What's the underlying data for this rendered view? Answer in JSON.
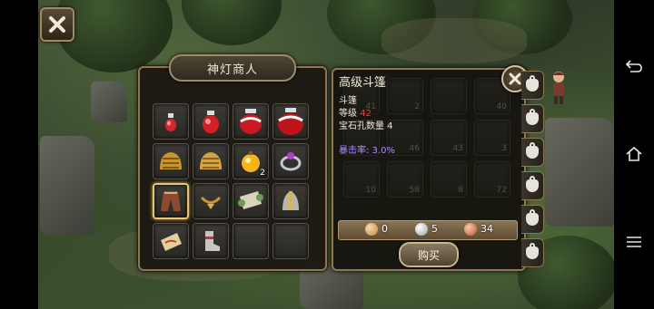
{
  "merchant": {
    "title": "神灯商人",
    "items": [
      {
        "icon": "small-red-potion-icon",
        "qty": ""
      },
      {
        "icon": "red-potion-icon",
        "qty": ""
      },
      {
        "icon": "large-red-potion-icon",
        "qty": ""
      },
      {
        "icon": "jumbo-red-potion-icon",
        "qty": ""
      },
      {
        "icon": "golden-helmet-icon",
        "qty": ""
      },
      {
        "icon": "golden-helmet-2-icon",
        "qty": ""
      },
      {
        "icon": "gold-orb-icon",
        "qty": "2"
      },
      {
        "icon": "purple-ring-icon",
        "qty": ""
      },
      {
        "icon": "cloak-icon",
        "qty": ""
      },
      {
        "icon": "amulet-icon",
        "qty": ""
      },
      {
        "icon": "scroll-icon",
        "qty": ""
      },
      {
        "icon": "silver-helmet-icon",
        "qty": ""
      },
      {
        "icon": "treasure-map-icon",
        "qty": ""
      },
      {
        "icon": "boots-icon",
        "qty": ""
      },
      {
        "icon": "empty-slot",
        "qty": ""
      },
      {
        "icon": "empty-slot",
        "qty": ""
      }
    ],
    "selected_index": 8
  },
  "detail": {
    "name": "高级斗篷",
    "type": "斗篷",
    "level_label": "等级",
    "level_value": "42",
    "gem_sockets": "宝石孔数量 4",
    "crit": "暴击率: 3.0%",
    "price": {
      "gold": "0",
      "silver": "5",
      "copper": "34"
    },
    "buy_label": "购买"
  },
  "background_inventory": [
    "41",
    "2",
    "",
    "40",
    "",
    "46",
    "43",
    "3",
    "10",
    "58",
    "8",
    "72"
  ],
  "colors": {
    "frame": "#8d7752",
    "level_red": "#ff3b2f",
    "crit_purple": "#a98cff"
  }
}
